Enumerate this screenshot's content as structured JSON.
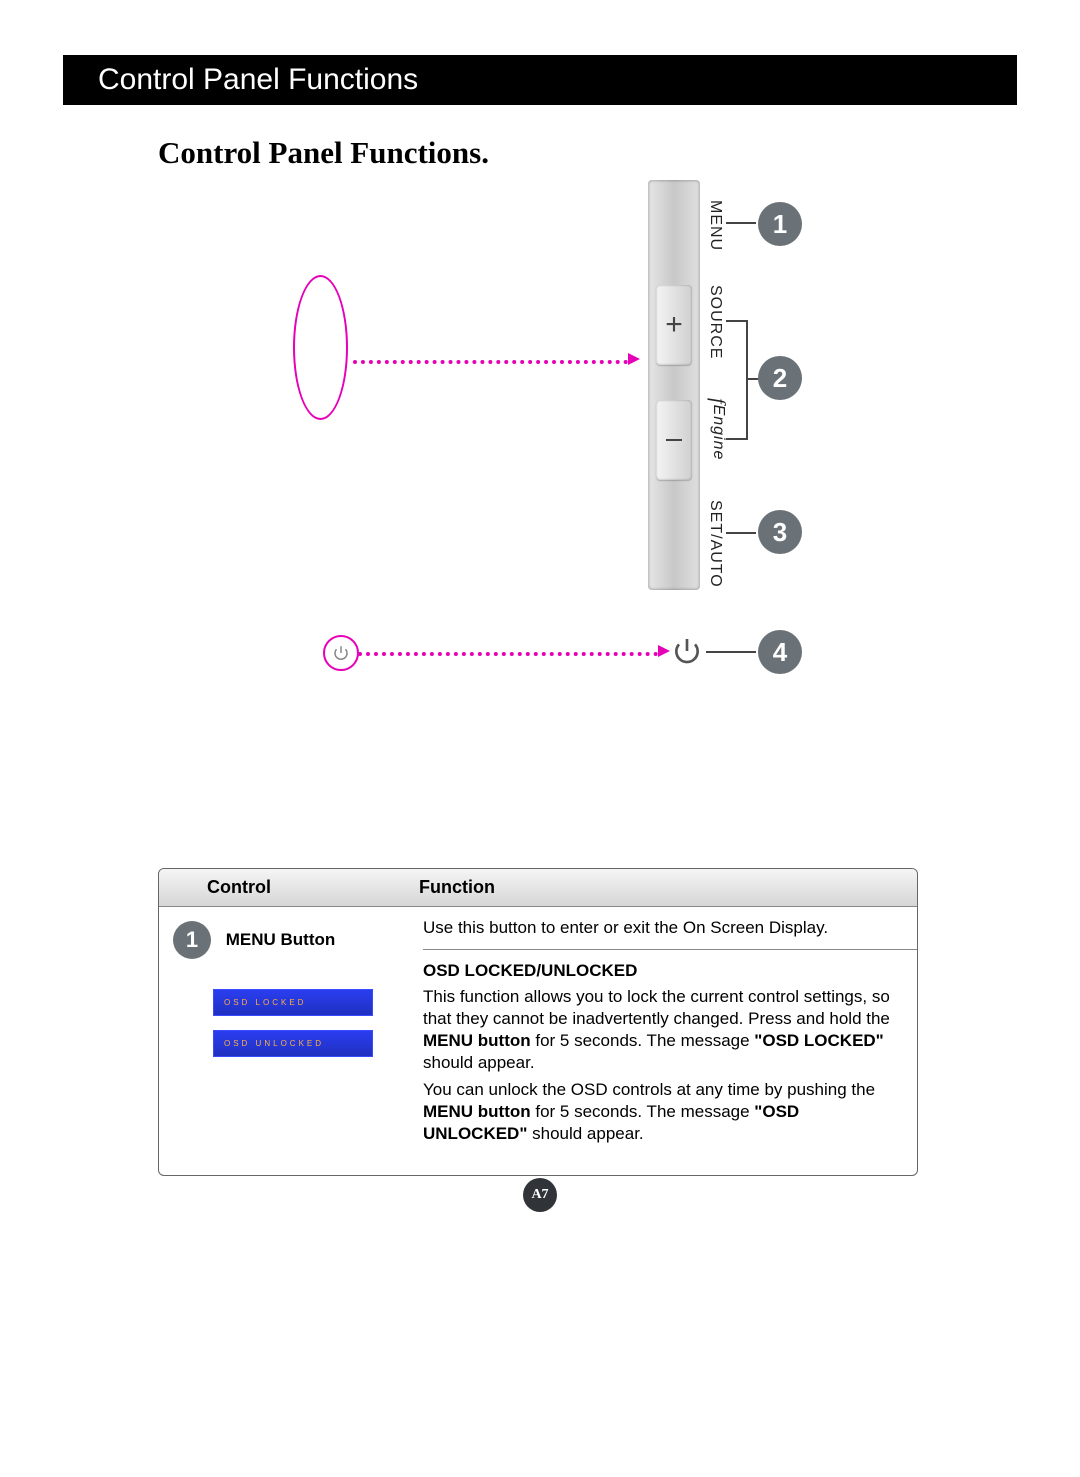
{
  "header": {
    "title": "Control Panel Functions"
  },
  "subtitle": "Control Panel Functions.",
  "panel": {
    "labels": {
      "menu": "MENU",
      "source": "SOURCE",
      "engine": "Engine",
      "setauto": "SET/AUTO"
    },
    "plus": "+"
  },
  "callouts": {
    "n1": "1",
    "n2": "2",
    "n3": "3",
    "n4": "4"
  },
  "table": {
    "headers": {
      "control": "Control",
      "function": "Function"
    },
    "row1": {
      "num": "1",
      "label": "MENU Button",
      "p1": "Use this button to enter or exit the On Screen Display.",
      "h": "OSD LOCKED/UNLOCKED",
      "p2a": "This function allows you to lock the current control settings, so that they cannot be inadvertently changed. Press and hold the ",
      "p2b": "MENU button",
      "p2c": " for 5 seconds. The message ",
      "p2d": "\"OSD LOCKED\"",
      "p2e": " should appear.",
      "p3a": "You can unlock the OSD controls at any time by pushing the ",
      "p3b": "MENU button",
      "p3c": " for 5 seconds. The message ",
      "p3d": "\"OSD UNLOCKED\"",
      "p3e": " should appear."
    },
    "osd": {
      "locked": "OSD LOCKED",
      "unlocked": "OSD UNLOCKED"
    }
  },
  "pagenum": "A7"
}
